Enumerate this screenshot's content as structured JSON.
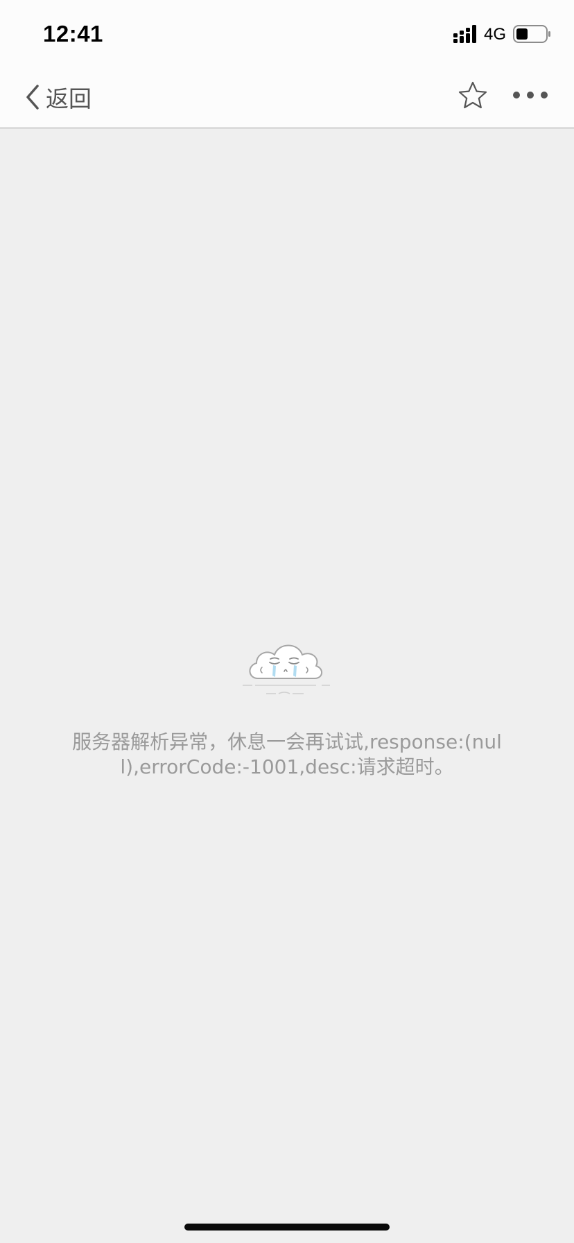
{
  "status_bar": {
    "time": "12:41",
    "network": "4G",
    "signal_icon": "signal-bars-icon",
    "battery_icon": "battery-icon"
  },
  "nav_bar": {
    "back_label": "返回",
    "back_icon": "chevron-left-icon",
    "star_icon": "star-outline-icon",
    "more_icon": "more-dots-icon"
  },
  "error_page": {
    "illustration": "crying-cloud-icon",
    "message": "服务器解析异常，休息一会再试试,response:(null),errorCode:-1001,desc:请求超时。"
  },
  "colors": {
    "background": "#efefef",
    "bar": "#fcfcfc",
    "message_text": "#9a9a9a",
    "tear_blue": "#a9d8f0"
  }
}
